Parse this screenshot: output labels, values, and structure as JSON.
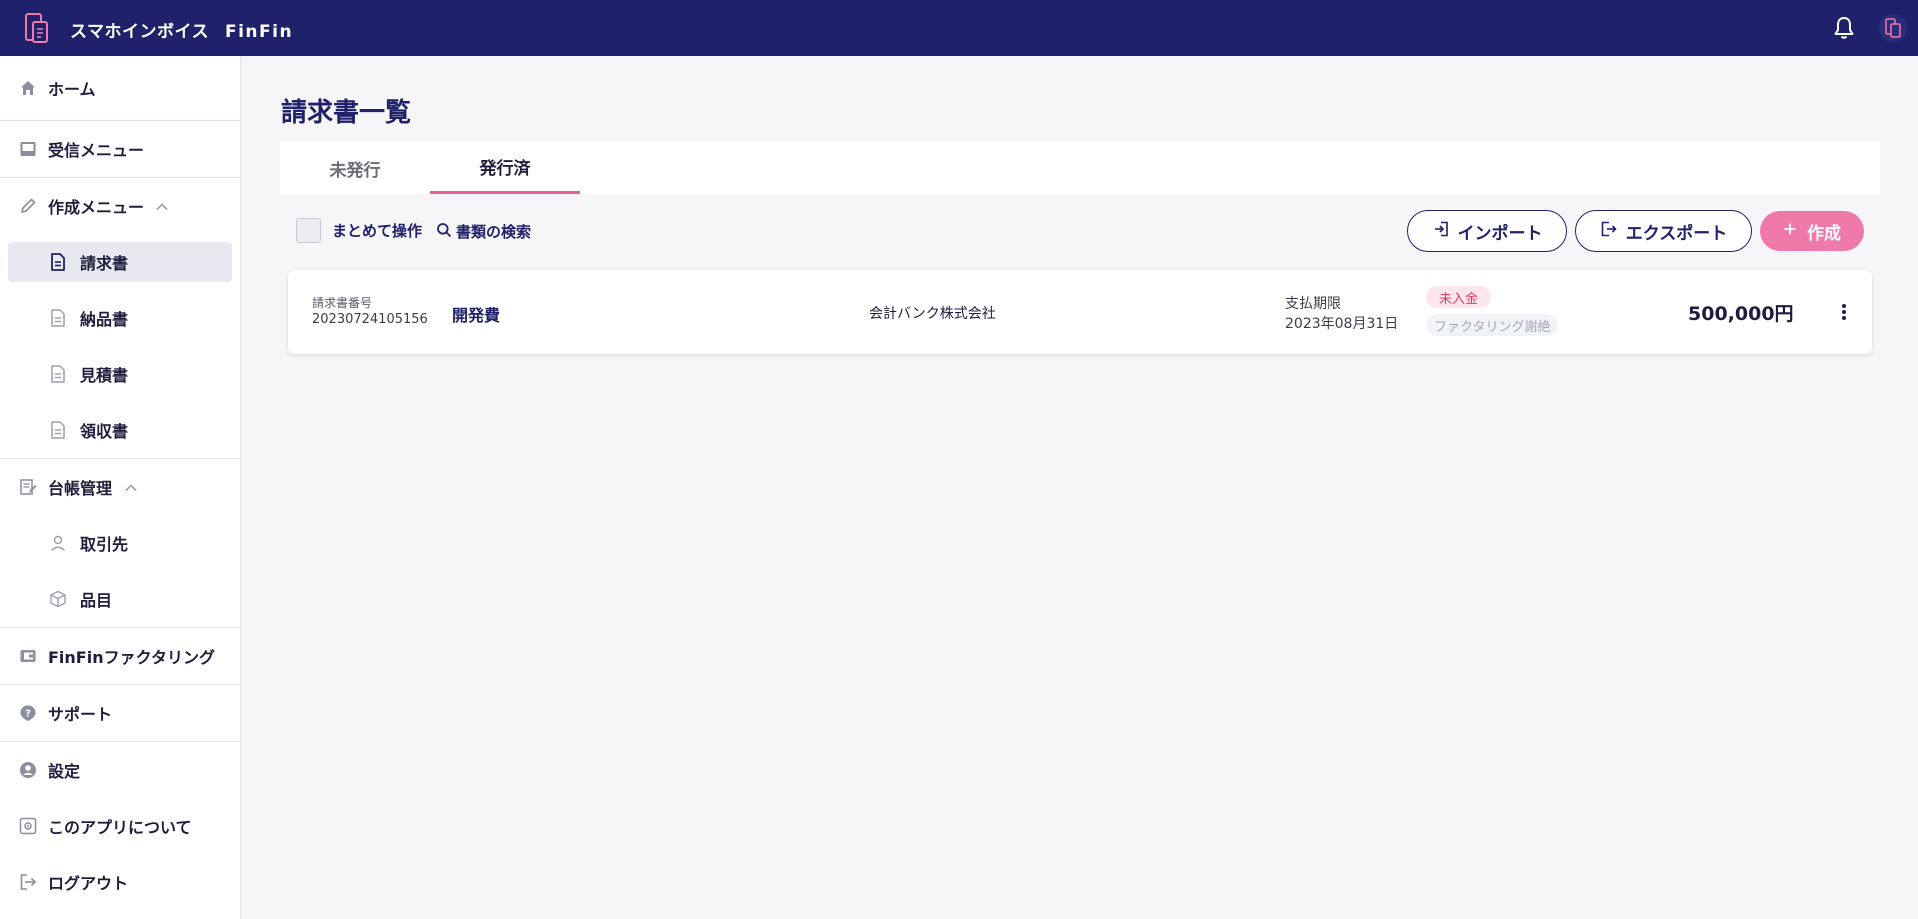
{
  "header": {
    "brand": "スマホインボイス",
    "brand_sub": "FinFin",
    "icons": {
      "logo": "invoice-logo-icon",
      "bell": "bell-icon",
      "avatar": "avatar-logo-icon"
    }
  },
  "colors": {
    "header_bg": "#1f216a",
    "accent_pink": "#ef7aaa",
    "tab_underline": "#e8609a",
    "navy_text": "#1f216a",
    "unpaid_badge": "#e23a6a"
  },
  "sidebar": {
    "home": "ホーム",
    "inbox": "受信メニュー",
    "create_menu": "作成メニュー",
    "create_items": [
      "請求書",
      "納品書",
      "見積書",
      "領収書"
    ],
    "ledger": "台帳管理",
    "ledger_items": [
      "取引先",
      "品目"
    ],
    "factoring": "FinFinファクタリング",
    "support": "サポート",
    "settings": "設定",
    "about": "このアプリについて",
    "logout": "ログアウト"
  },
  "main": {
    "title": "請求書一覧",
    "tabs": [
      {
        "label": "未発行",
        "active": false
      },
      {
        "label": "発行済",
        "active": true
      }
    ],
    "toolbar": {
      "bulk": "まとめて操作",
      "search": "書類の検索",
      "import": "インポート",
      "export": "エクスポート",
      "create": "作成"
    },
    "invoices": [
      {
        "number_label": "請求書番号",
        "number": "20230724105156",
        "subject": "開発費",
        "client": "会計バンク株式会社",
        "due_label": "支払期限",
        "due_date": "2023年08月31日",
        "status": "未入金",
        "factoring_status": "ファクタリング謝絶",
        "amount": "500,000円"
      }
    ]
  }
}
